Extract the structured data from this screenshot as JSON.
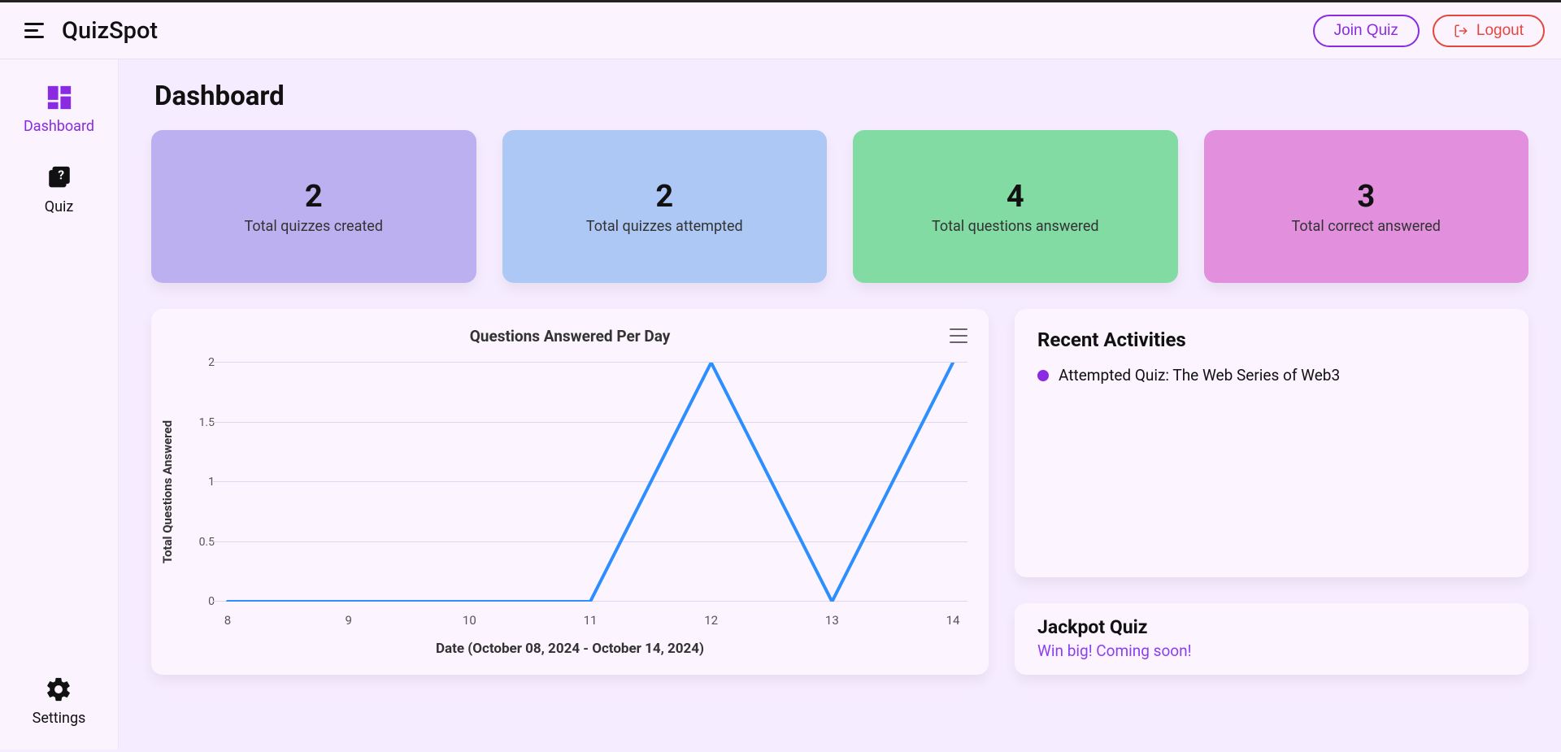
{
  "header": {
    "brand": "QuizSpot",
    "join_label": "Join Quiz",
    "logout_label": "Logout"
  },
  "sidebar": {
    "items": [
      {
        "label": "Dashboard",
        "active": true
      },
      {
        "label": "Quiz",
        "active": false
      }
    ],
    "settings_label": "Settings"
  },
  "page": {
    "title": "Dashboard"
  },
  "stats": [
    {
      "value": "2",
      "label": "Total quizzes created",
      "color": "#bdb0f1"
    },
    {
      "value": "2",
      "label": "Total quizzes attempted",
      "color": "#aec8f5"
    },
    {
      "value": "4",
      "label": "Total questions answered",
      "color": "#82dba3"
    },
    {
      "value": "3",
      "label": "Total correct answered",
      "color": "#e28fdd"
    }
  ],
  "recent": {
    "title": "Recent Activities",
    "items": [
      "Attempted Quiz: The Web Series of Web3"
    ]
  },
  "jackpot": {
    "title": "Jackpot Quiz",
    "subtitle": "Win big! Coming soon!"
  },
  "chart_data": {
    "type": "line",
    "title": "Questions Answered Per Day",
    "xlabel": "Date (October 08, 2024 - October 14, 2024)",
    "ylabel": "Total Questions Answered",
    "categories": [
      "8",
      "9",
      "10",
      "11",
      "12",
      "13",
      "14"
    ],
    "values": [
      0,
      0,
      0,
      0,
      2,
      0,
      2
    ],
    "ylim": [
      0,
      2
    ],
    "y_ticks": [
      "0",
      "0.5",
      "1",
      "1.5",
      "2"
    ],
    "line_color": "#2c8eff"
  }
}
